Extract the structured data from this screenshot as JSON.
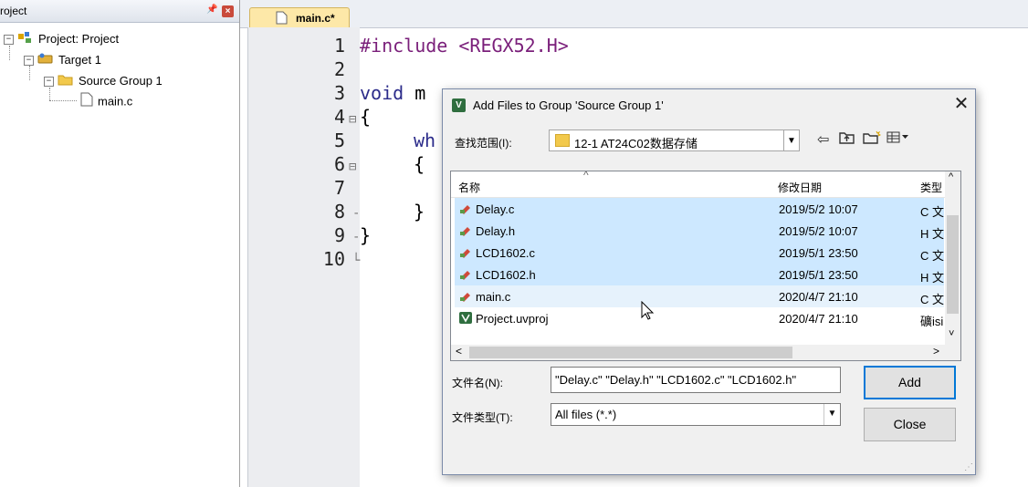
{
  "project_panel": {
    "title": "roject",
    "tree": {
      "project": "Project: Project",
      "target": "Target 1",
      "group": "Source Group 1",
      "file": "main.c"
    }
  },
  "editor": {
    "tab_label": "main.c*",
    "line_numbers": [
      "1",
      "2",
      "3",
      "4",
      "5",
      "6",
      "7",
      "8",
      "9",
      "10"
    ],
    "code": {
      "l1_kw": "#include",
      "l1_rest": " <REGX52.H>",
      "l3_kw": "void",
      "l3_rest": " m",
      "l4": "{",
      "l5": "wh",
      "l6": "{",
      "l8": "}",
      "l9": "}"
    }
  },
  "dialog": {
    "title": "Add Files to Group 'Source Group 1'",
    "close": "✕",
    "look_in_label": "查找范围(I):",
    "look_in_value": "12-1 AT24C02数据存储",
    "columns": {
      "name": "名称",
      "date": "修改日期",
      "type": "类型"
    },
    "files": [
      {
        "name": "Delay.c",
        "date": "2019/5/2 10:07",
        "type": "C 文"
      },
      {
        "name": "Delay.h",
        "date": "2019/5/2 10:07",
        "type": "H 文"
      },
      {
        "name": "LCD1602.c",
        "date": "2019/5/1 23:50",
        "type": "C 文"
      },
      {
        "name": "LCD1602.h",
        "date": "2019/5/1 23:50",
        "type": "H 文"
      },
      {
        "name": "main.c",
        "date": "2020/4/7 21:10",
        "type": "C 文"
      },
      {
        "name": "Project.uvproj",
        "date": "2020/4/7 21:10",
        "type": "礦isi"
      }
    ],
    "filename_label": "文件名(N):",
    "filename_value": "\"Delay.c\" \"Delay.h\" \"LCD1602.c\" \"LCD1602.h\"",
    "filetype_label": "文件类型(T):",
    "filetype_value": "All files (*.*)",
    "add_button": "Add",
    "close_button": "Close"
  }
}
